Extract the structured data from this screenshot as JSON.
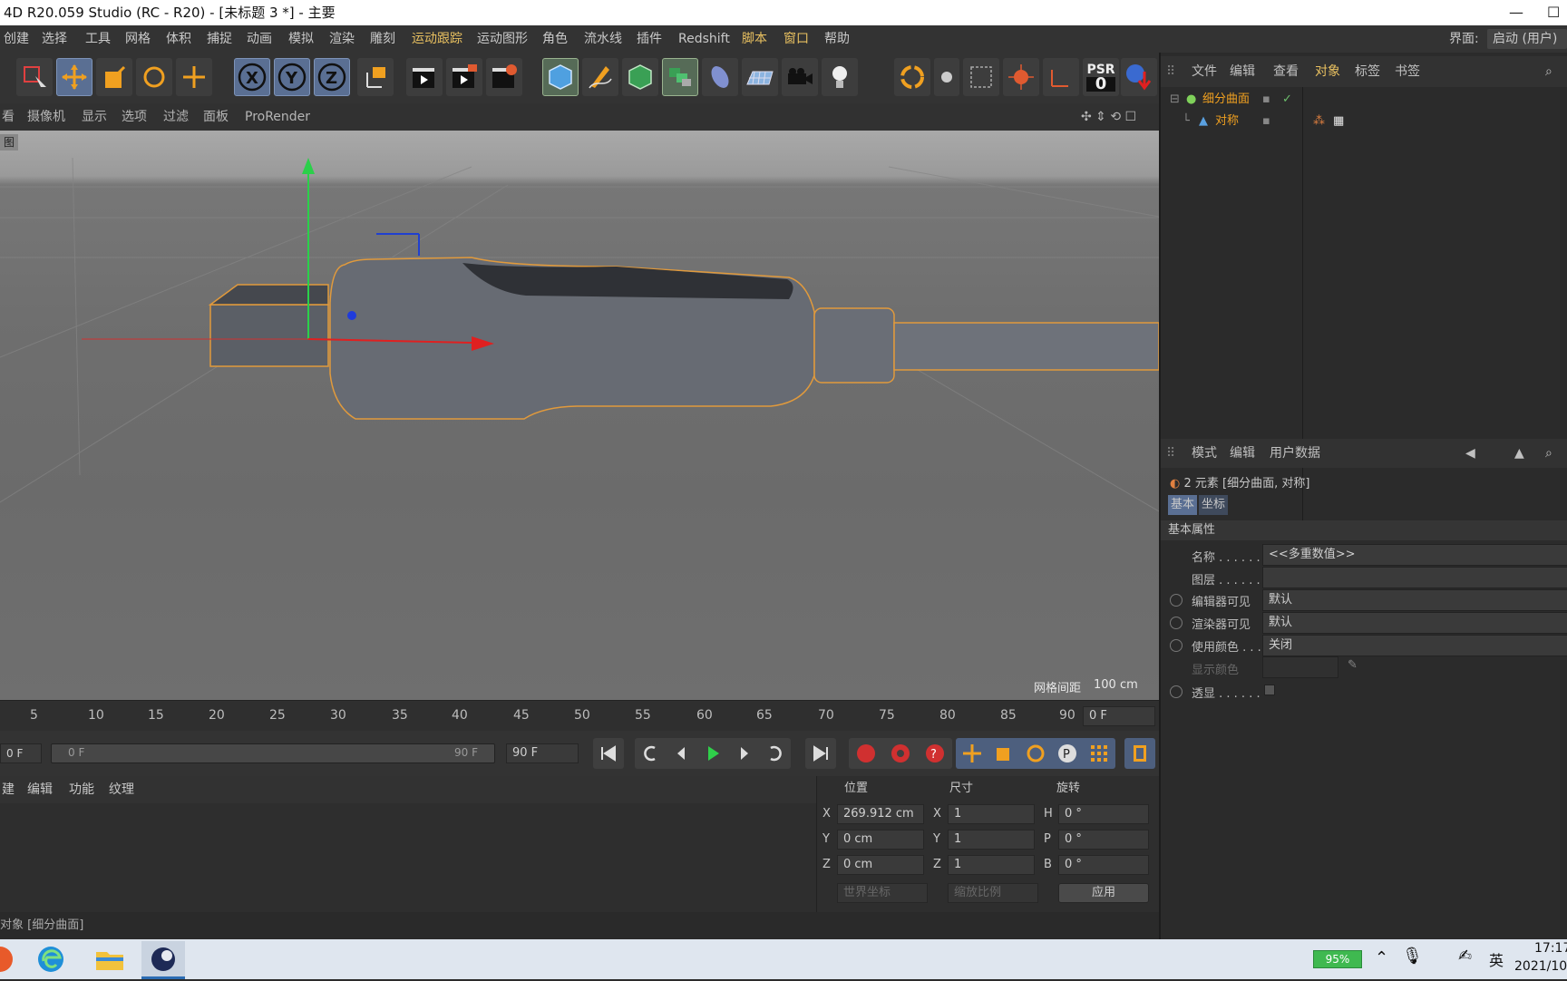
{
  "title_bar": {
    "title": "4D R20.059 Studio (RC - R20) - [未标题 3 *] - 主要",
    "minimize": "—",
    "maximize": "☐"
  },
  "menu": {
    "items": [
      "创建",
      "选择",
      "工具",
      "网格",
      "体积",
      "捕捉",
      "动画",
      "模拟",
      "渲染",
      "雕刻",
      "运动跟踪",
      "运动图形",
      "角色",
      "流水线",
      "插件",
      "Redshift",
      "脚本",
      "窗口",
      "帮助"
    ],
    "layout_label": "界面:",
    "layout_value": "启动 (用户)"
  },
  "toolbar": {
    "psr_label": "PSR",
    "psr_value": "0",
    "icons": [
      "live-selection-icon",
      "move-icon",
      "scale-icon",
      "rotate-icon",
      "create-icon",
      "x-axis-icon",
      "y-axis-icon",
      "z-axis-icon",
      "coordinate-system-icon",
      "render-view-icon",
      "render-picture-viewer-icon",
      "render-settings-icon",
      "cube-icon",
      "pen-icon",
      "subdivision-icon",
      "array-icon",
      "deformer-icon",
      "floor-icon",
      "camera-icon",
      "light-icon"
    ]
  },
  "viewport_menu": {
    "items": [
      "看",
      "摄像机",
      "显示",
      "选项",
      "过滤",
      "面板",
      "ProRender"
    ],
    "view_label": "图"
  },
  "viewport": {
    "grid_spacing_label": "网格间距",
    "grid_spacing_value": "100 cm"
  },
  "timeline": {
    "ticks": [
      "5",
      "10",
      "15",
      "20",
      "25",
      "30",
      "35",
      "40",
      "45",
      "50",
      "55",
      "60",
      "65",
      "70",
      "75",
      "80",
      "85",
      "90"
    ],
    "current_frame": "0 F"
  },
  "playback": {
    "start_field": "0 F",
    "range_start": "0 F",
    "range_end": "90 F",
    "end_field": "90 F"
  },
  "material_panel": {
    "tabs": [
      "建",
      "编辑",
      "功能",
      "纹理"
    ]
  },
  "coordinates": {
    "headers": [
      "位置",
      "尺寸",
      "旋转"
    ],
    "rows": [
      {
        "axis": "X",
        "pos": "269.912 cm",
        "size_axis": "X",
        "size": "1",
        "rot_axis": "H",
        "rot": "0 °"
      },
      {
        "axis": "Y",
        "pos": "0 cm",
        "size_axis": "Y",
        "size": "1",
        "rot_axis": "P",
        "rot": "0 °"
      },
      {
        "axis": "Z",
        "pos": "0 cm",
        "size_axis": "Z",
        "size": "1",
        "rot_axis": "B",
        "rot": "0 °"
      }
    ],
    "world_coord": "世界坐标",
    "scale_mode": "缩放比例",
    "apply": "应用"
  },
  "status": {
    "text": "对象 [细分曲面]"
  },
  "object_manager": {
    "menu": [
      "文件",
      "编辑",
      "查看",
      "对象",
      "标签",
      "书签"
    ],
    "objects": [
      {
        "name": "细分曲面"
      },
      {
        "name": "对称"
      }
    ]
  },
  "attribute_manager": {
    "menu": [
      "模式",
      "编辑",
      "用户数据"
    ],
    "selection_info": "2 元素 [细分曲面, 对称]",
    "tabs": [
      "基本",
      "坐标"
    ],
    "section_title": "基本属性",
    "fields": [
      {
        "label": "名称 . . . . . .",
        "value": "<<多重数值>>"
      },
      {
        "label": "图层 . . . . . .",
        "value": ""
      },
      {
        "label": "编辑器可见",
        "value": "默认"
      },
      {
        "label": "渲染器可见",
        "value": "默认"
      },
      {
        "label": "使用颜色 . . .",
        "value": "关闭"
      },
      {
        "label": "显示颜色",
        "value": ""
      },
      {
        "label": "透显 . . . . . .",
        "value": ""
      }
    ]
  },
  "taskbar": {
    "battery": "95%",
    "ime": "英",
    "time": "17:17",
    "date": "2021/10"
  },
  "colors": {
    "accent_orange": "#e8a020",
    "selection_blue": "#5a6f93",
    "object_green": "#7fd15a",
    "viewport_bg": "#6e6e6e"
  }
}
